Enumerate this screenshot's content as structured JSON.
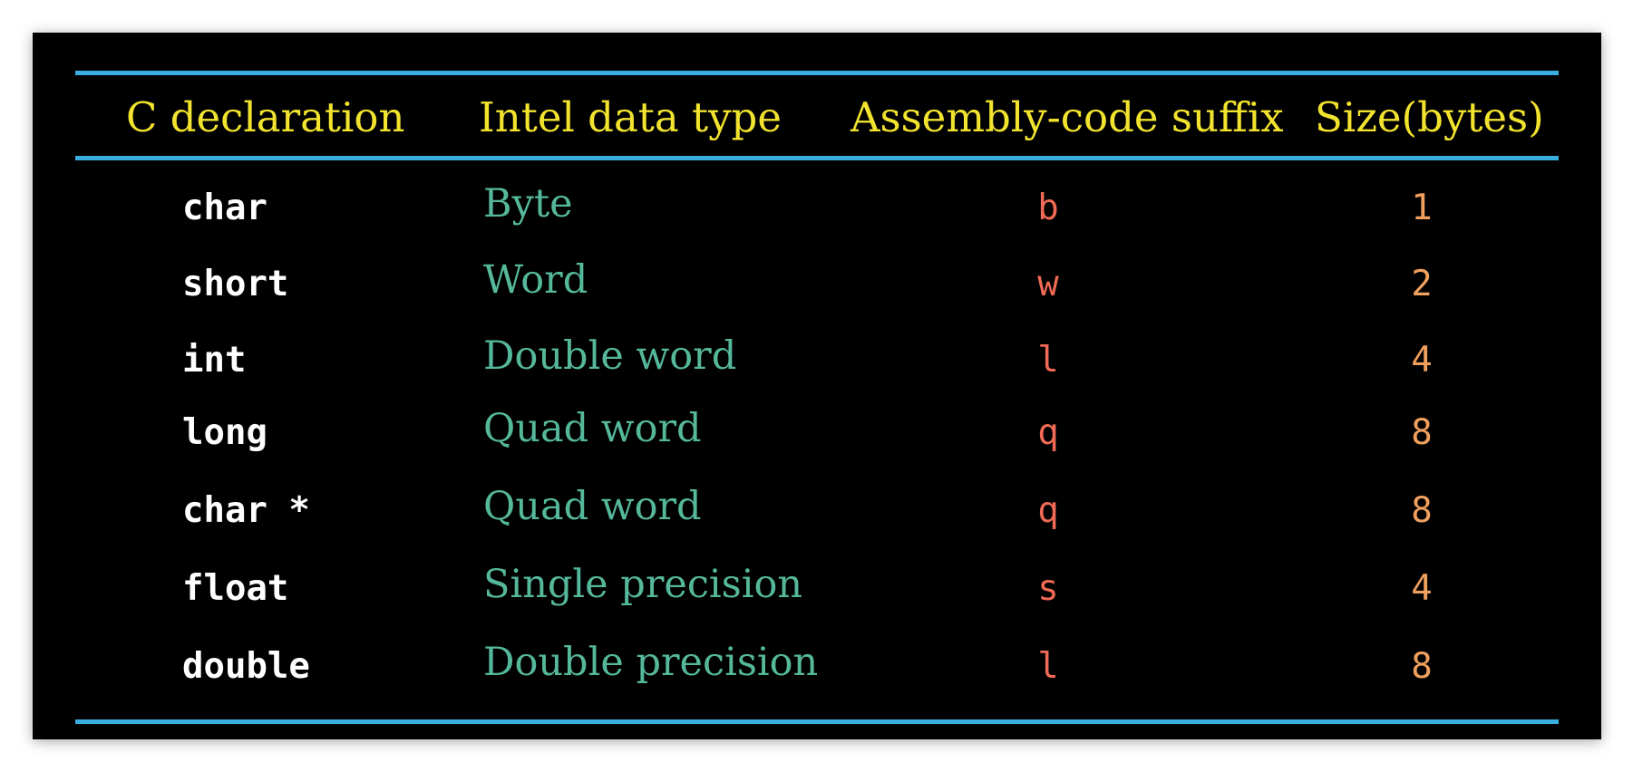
{
  "table": {
    "headers": [
      "C declaration",
      "Intel data type",
      "Assembly-code suffix",
      "Size(bytes)"
    ],
    "rows": [
      {
        "c_declaration": "char",
        "intel_data_type": "Byte",
        "suffix": "b",
        "size": "1"
      },
      {
        "c_declaration": "short",
        "intel_data_type": "Word",
        "suffix": "w",
        "size": "2"
      },
      {
        "c_declaration": "int",
        "intel_data_type": "Double word",
        "suffix": "l",
        "size": "4"
      },
      {
        "c_declaration": "long",
        "intel_data_type": "Quad word",
        "suffix": "q",
        "size": "8"
      },
      {
        "c_declaration": "char *",
        "intel_data_type": "Quad word",
        "suffix": "q",
        "size": "8"
      },
      {
        "c_declaration": "float",
        "intel_data_type": "Single precision",
        "suffix": "s",
        "size": "4"
      },
      {
        "c_declaration": "double",
        "intel_data_type": "Double precision",
        "suffix": "l",
        "size": "8"
      }
    ]
  },
  "colors": {
    "background": "#000000",
    "rule": "#3aaee0",
    "header_text": "#f2e32e",
    "c_declaration_text": "#ffffff",
    "intel_type_text": "#55b89a",
    "suffix_text": "#f06a55",
    "size_text": "#f0a05e"
  }
}
